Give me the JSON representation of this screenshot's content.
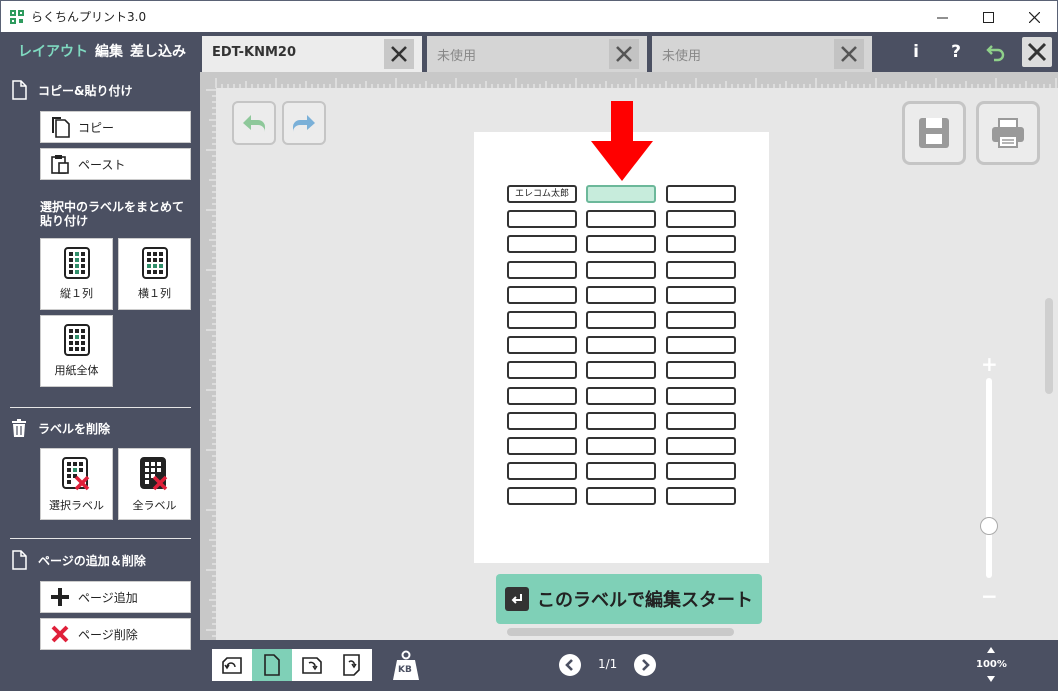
{
  "window": {
    "title": "らくちんプリント3.0",
    "minimize": "—",
    "maximize": "☐",
    "close": "✕"
  },
  "header": {
    "mode_tabs": [
      {
        "label": "レイアウト",
        "active": true
      },
      {
        "label": "編集",
        "active": false
      },
      {
        "label": "差し込み",
        "active": false
      }
    ],
    "doc_tabs": [
      {
        "label": "EDT-KNM20",
        "active": true
      },
      {
        "label": "未使用",
        "active": false
      },
      {
        "label": "未使用",
        "active": false
      }
    ],
    "info_label": "i",
    "help_label": "?"
  },
  "sidebar": {
    "copy_paste": {
      "heading": "コピー&貼り付け",
      "copy_label": "コピー",
      "paste_label": "ペースト",
      "bulk_heading": "選択中のラベルをまとめて貼り付け",
      "column_label": "縦１列",
      "row_label": "横１列",
      "all_sheet_label": "用紙全体"
    },
    "delete": {
      "heading": "ラベルを削除",
      "selected_label": "選択ラベル",
      "all_label": "全ラベル"
    },
    "page": {
      "heading": "ページの追加＆削除",
      "add_label": "ページ追加",
      "delete_label": "ページ削除"
    }
  },
  "canvas": {
    "labels": {
      "columns": 3,
      "rows": 13,
      "selected": {
        "row": 0,
        "col": 1
      },
      "filled": [
        {
          "row": 0,
          "col": 0,
          "text": "エレコム太郎"
        }
      ]
    },
    "start_button": "このラベルで編集スタート",
    "zoom_plus": "+",
    "zoom_minus": "−",
    "zoom_slider_fraction": 0.26
  },
  "footer": {
    "weight_icon_text": "KB",
    "page_indicator": "1/1",
    "zoom_level": "100%"
  },
  "colors": {
    "dark_panel": "#4b5062",
    "accent": "#7fd0b7",
    "selected_cell": "#c7ecdc",
    "arrow": "#e10000"
  }
}
